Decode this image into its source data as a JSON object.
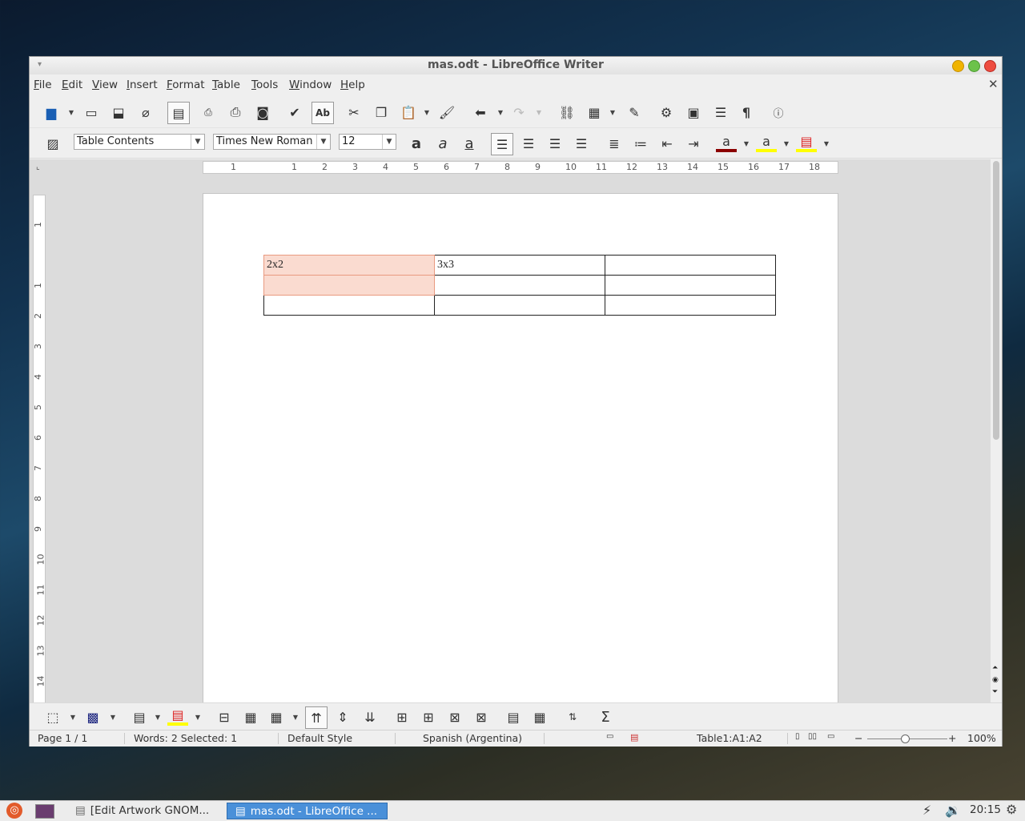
{
  "window": {
    "title": "mas.odt - LibreOffice Writer"
  },
  "menu": [
    {
      "label": "File",
      "u": "F",
      "rest": "ile"
    },
    {
      "label": "Edit",
      "u": "E",
      "rest": "dit"
    },
    {
      "label": "View",
      "u": "V",
      "rest": "iew"
    },
    {
      "label": "Insert",
      "u": "I",
      "rest": "nsert"
    },
    {
      "label": "Format",
      "u": "F",
      "rest": "ormat"
    },
    {
      "label": "Table",
      "u": "T",
      "rest": "able"
    },
    {
      "label": "Tools",
      "u": "T",
      "rest": "ools"
    },
    {
      "label": "Window",
      "u": "W",
      "rest": "indow"
    },
    {
      "label": "Help",
      "u": "H",
      "rest": "elp"
    }
  ],
  "formatting": {
    "paragraph_style": "Table Contents",
    "font_name": "Times New Roman",
    "font_size": "12"
  },
  "ruler": {
    "h_ticks": [
      "1",
      "1",
      "2",
      "3",
      "4",
      "5",
      "6",
      "7",
      "8",
      "9",
      "10",
      "11",
      "12",
      "13",
      "14",
      "15",
      "16",
      "17",
      "18"
    ],
    "v_ticks": [
      "1",
      "1",
      "2",
      "3",
      "4",
      "5",
      "6",
      "7",
      "8",
      "9",
      "10",
      "11",
      "12",
      "13",
      "14"
    ]
  },
  "table": {
    "rows": [
      [
        "2x2",
        "3x3",
        ""
      ],
      [
        "",
        "",
        ""
      ],
      [
        "",
        "",
        ""
      ]
    ]
  },
  "status": {
    "page": "Page 1 / 1",
    "words": "Words: 2 Selected: 1",
    "style": "Default Style",
    "language": "Spanish (Argentina)",
    "cell": "Table1:A1:A2",
    "zoom": "100%"
  },
  "taskbar": {
    "task1": "[Edit  Artwork GNOM...",
    "task2": "mas.odt - LibreOffice ...",
    "clock": "20:15"
  },
  "colors": {
    "selection": "#fadbd0",
    "font_color": "#8b0000",
    "highlight": "#ffff00"
  }
}
